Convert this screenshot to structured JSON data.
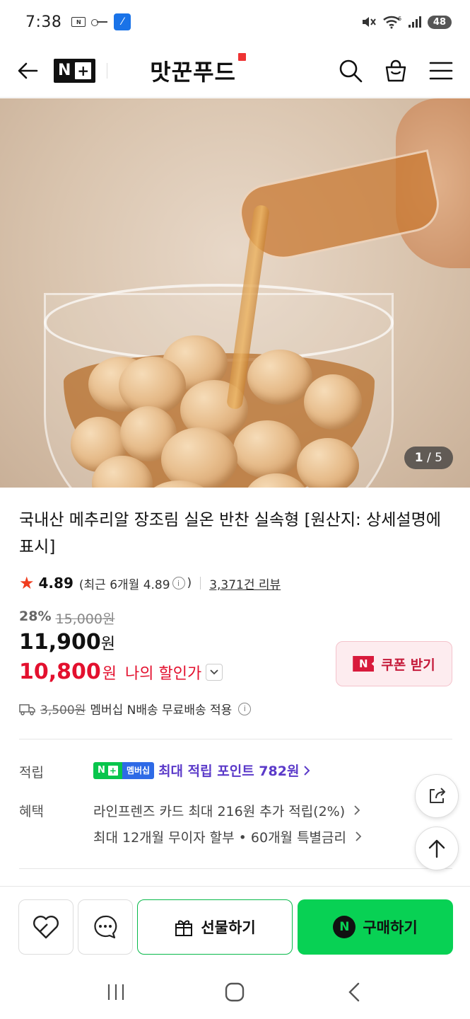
{
  "status_bar": {
    "time": "7:38",
    "battery": "48",
    "left_icons": [
      "nfc-badge-icon",
      "key-icon",
      "app-icon"
    ],
    "right_icons": [
      "mute-icon",
      "wifi-icon",
      "signal-icon",
      "battery-icon"
    ],
    "wifi_label": "6"
  },
  "header": {
    "logo": "N+",
    "store_name": "맛꾼푸드",
    "icons": [
      "back-arrow-icon",
      "search-icon",
      "shopping-bag-icon",
      "menu-icon"
    ]
  },
  "gallery": {
    "current": "1",
    "separator": "/",
    "total": "5"
  },
  "product": {
    "title": "국내산 메추리알 장조림 실온 반찬 실속형 [원산지: 상세설명에 표시]",
    "rating": "4.89",
    "rating_recent_prefix": "(최근 6개월 4.89",
    "rating_recent_suffix": ")",
    "review_count": "3,371건 리뷰",
    "discount_rate": "28%",
    "original_price": "15,000원",
    "sale_price": "11,900",
    "won": "원",
    "my_price": "10,800",
    "my_price_label": "나의 할인가",
    "coupon_label": "쿠폰 받기",
    "coupon_badge": "N"
  },
  "shipping": {
    "original_fee": "3,500원",
    "text": "멤버십 N배송 무료배송 적용"
  },
  "benefits": {
    "points_label": "적립",
    "membership_badge_n": "N",
    "membership_badge_plus": "+",
    "membership_badge_text": "멤버십",
    "points_text": "최대 적립 포인트 782원",
    "benefit_label": "혜택",
    "card_benefit": "라인프렌즈 카드 최대 216원 추가 적립(2%)",
    "installment_benefit": "최대 12개월 무이자 할부 • 60개월 특별금리"
  },
  "bottom_bar": {
    "gift_label": "선물하기",
    "buy_label": "구매하기",
    "buy_badge": "N"
  },
  "colors": {
    "accent_green": "#08d154",
    "price_red": "#e3102e",
    "points_purple": "#5b3ac9",
    "coupon_red": "#c51a3a"
  }
}
